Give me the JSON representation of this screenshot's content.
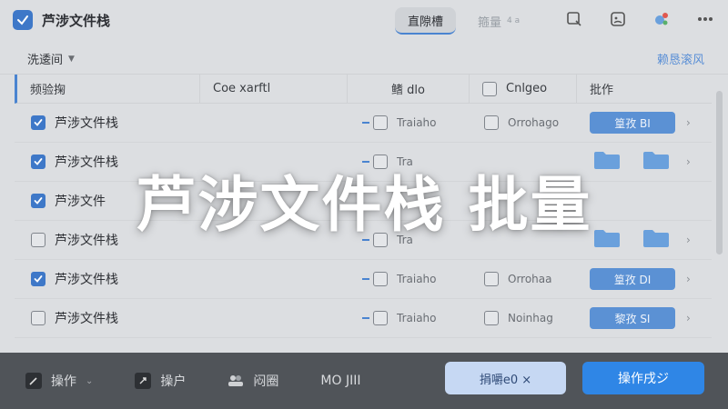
{
  "colors": {
    "accent": "#3e78c8",
    "primary_button": "#2f86e6",
    "secondary_button": "#c6d8f3",
    "bottom_bar": "#505459",
    "badge": "#5b91d4"
  },
  "header": {
    "app_icon": "checkbox-icon",
    "title": "芦涉文件栈",
    "tabs": [
      {
        "label": "直隙槽",
        "count": ""
      },
      {
        "label": "箍量",
        "count": "4 a"
      }
    ],
    "icons": [
      "search-icon",
      "image-icon",
      "ai-assistant-icon",
      "more-icon"
    ]
  },
  "filter": {
    "label": "洗逶间",
    "link": "赖恳滚风"
  },
  "table": {
    "columns": [
      "频验掬",
      "Coe xarftl",
      "鳍 dlo",
      "Cnlgeo",
      "批作"
    ],
    "rows": [
      {
        "checked": true,
        "name": "芦涉文件栈",
        "status": "Traiaho",
        "option": "Orrohago",
        "action": "butt",
        "action_label": "篁孜 BI"
      },
      {
        "checked": true,
        "name": "芦涉文件栈",
        "status": "Tra",
        "option": "",
        "action": "folders",
        "action_label": ""
      },
      {
        "checked": true,
        "name": "芦涉文件",
        "status": "",
        "option": "",
        "action": "none",
        "action_label": ""
      },
      {
        "checked": false,
        "name": "芦涉文件栈",
        "status": "Tra",
        "option": "",
        "action": "folders",
        "action_label": ""
      },
      {
        "checked": true,
        "name": "芦涉文件栈",
        "status": "Traiaho",
        "option": "Orrohaa",
        "action": "butt",
        "action_label": "篁孜 DI"
      },
      {
        "checked": false,
        "name": "芦涉文件栈",
        "status": "Traiaho",
        "option": "Noinhag",
        "action": "butt",
        "action_label": "黎孜 SI"
      }
    ]
  },
  "bottom": {
    "items": [
      {
        "icon": "pen-icon",
        "label": "操作",
        "caret": true
      },
      {
        "icon": "pen-tool-icon",
        "label": "操户",
        "caret": false
      },
      {
        "icon": "people-icon",
        "label": "闷圈",
        "caret": false
      },
      {
        "icon": "",
        "label": "MO JIII",
        "caret": false
      }
    ],
    "secondary_button": "捐嚼e0 ×",
    "primary_button": "操作戌ジ"
  },
  "overlay": {
    "title": "芦涉文件栈 批量"
  }
}
